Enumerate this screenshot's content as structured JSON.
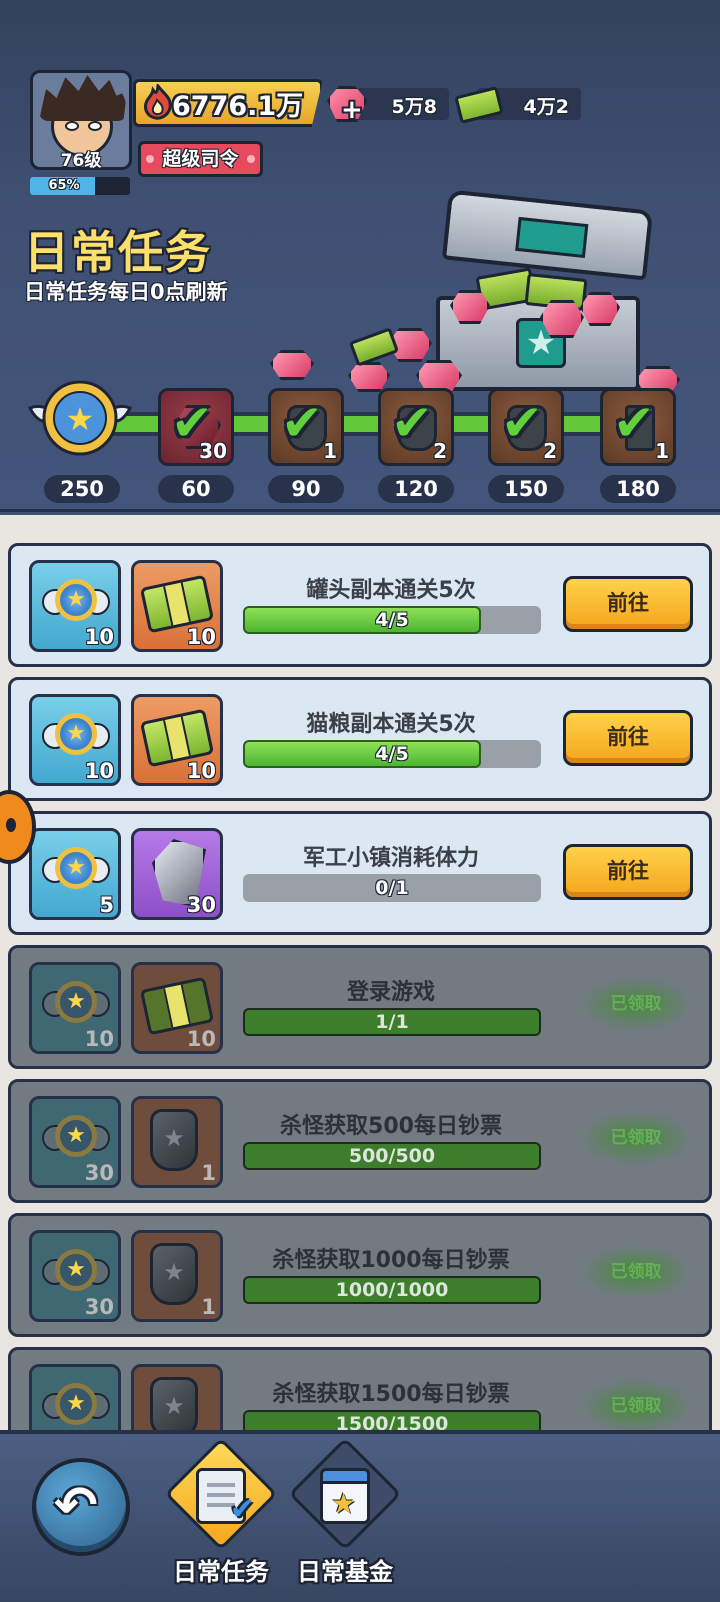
{
  "player": {
    "level": "76级",
    "xp_percent": "65%",
    "xp_fraction": 0.65,
    "power": "6776.1万",
    "vip": "超级司令",
    "gems": "5万8",
    "cash": "4万2",
    "gem_plus": "+"
  },
  "header": {
    "title": "日常任务",
    "subtitle": "日常任务每日0点刷新"
  },
  "milestones": {
    "progress_fraction": 1.0,
    "items": [
      {
        "points": "60",
        "count": "30",
        "icon": "ruby-icon",
        "claimed": true
      },
      {
        "points": "90",
        "count": "1",
        "icon": "dogtag-icon",
        "claimed": true
      },
      {
        "points": "120",
        "count": "2",
        "icon": "dogtag-icon",
        "claimed": true
      },
      {
        "points": "150",
        "count": "2",
        "icon": "dogtag-icon",
        "claimed": true
      },
      {
        "points": "180",
        "count": "1",
        "icon": "key-icon",
        "claimed": true
      }
    ],
    "total": "250"
  },
  "tasks": [
    {
      "title": "罐头副本通关5次",
      "progress": "4/5",
      "fraction": 0.8,
      "reward1": "10",
      "reward2": "10",
      "reward2_icon": "cash-icon",
      "action": "前往",
      "done": false
    },
    {
      "title": "猫粮副本通关5次",
      "progress": "4/5",
      "fraction": 0.8,
      "reward1": "10",
      "reward2": "10",
      "reward2_icon": "cash-icon",
      "action": "前往",
      "done": false
    },
    {
      "title": "军工小镇消耗体力",
      "progress": "0/1",
      "fraction": 0.0,
      "reward1": "5",
      "reward2": "30",
      "reward2_icon": "crystal-icon",
      "action": "前往",
      "done": false
    },
    {
      "title": "登录游戏",
      "progress": "1/1",
      "fraction": 1.0,
      "reward1": "10",
      "reward2": "10",
      "reward2_icon": "cash-icon",
      "action": "已领取",
      "done": true
    },
    {
      "title": "杀怪获取500每日钞票",
      "progress": "500/500",
      "fraction": 1.0,
      "reward1": "30",
      "reward2": "1",
      "reward2_icon": "dogtag-icon",
      "action": "已领取",
      "done": true
    },
    {
      "title": "杀怪获取1000每日钞票",
      "progress": "1000/1000",
      "fraction": 1.0,
      "reward1": "30",
      "reward2": "1",
      "reward2_icon": "dogtag-icon",
      "action": "已领取",
      "done": true
    },
    {
      "title": "杀怪获取1500每日钞票",
      "progress": "1500/1500",
      "fraction": 1.0,
      "reward1": "",
      "reward2": "",
      "reward2_icon": "dogtag-icon",
      "action": "已领取",
      "done": true
    }
  ],
  "bottom_nav": {
    "back_icon": "back-arrow-icon",
    "tabs": [
      {
        "label": "日常任务",
        "active": true
      },
      {
        "label": "日常基金",
        "active": false
      }
    ]
  },
  "colors": {
    "accent_yellow": "#fde06b",
    "progress_green": "#63c93b",
    "button_orange": "#f4a51c"
  }
}
